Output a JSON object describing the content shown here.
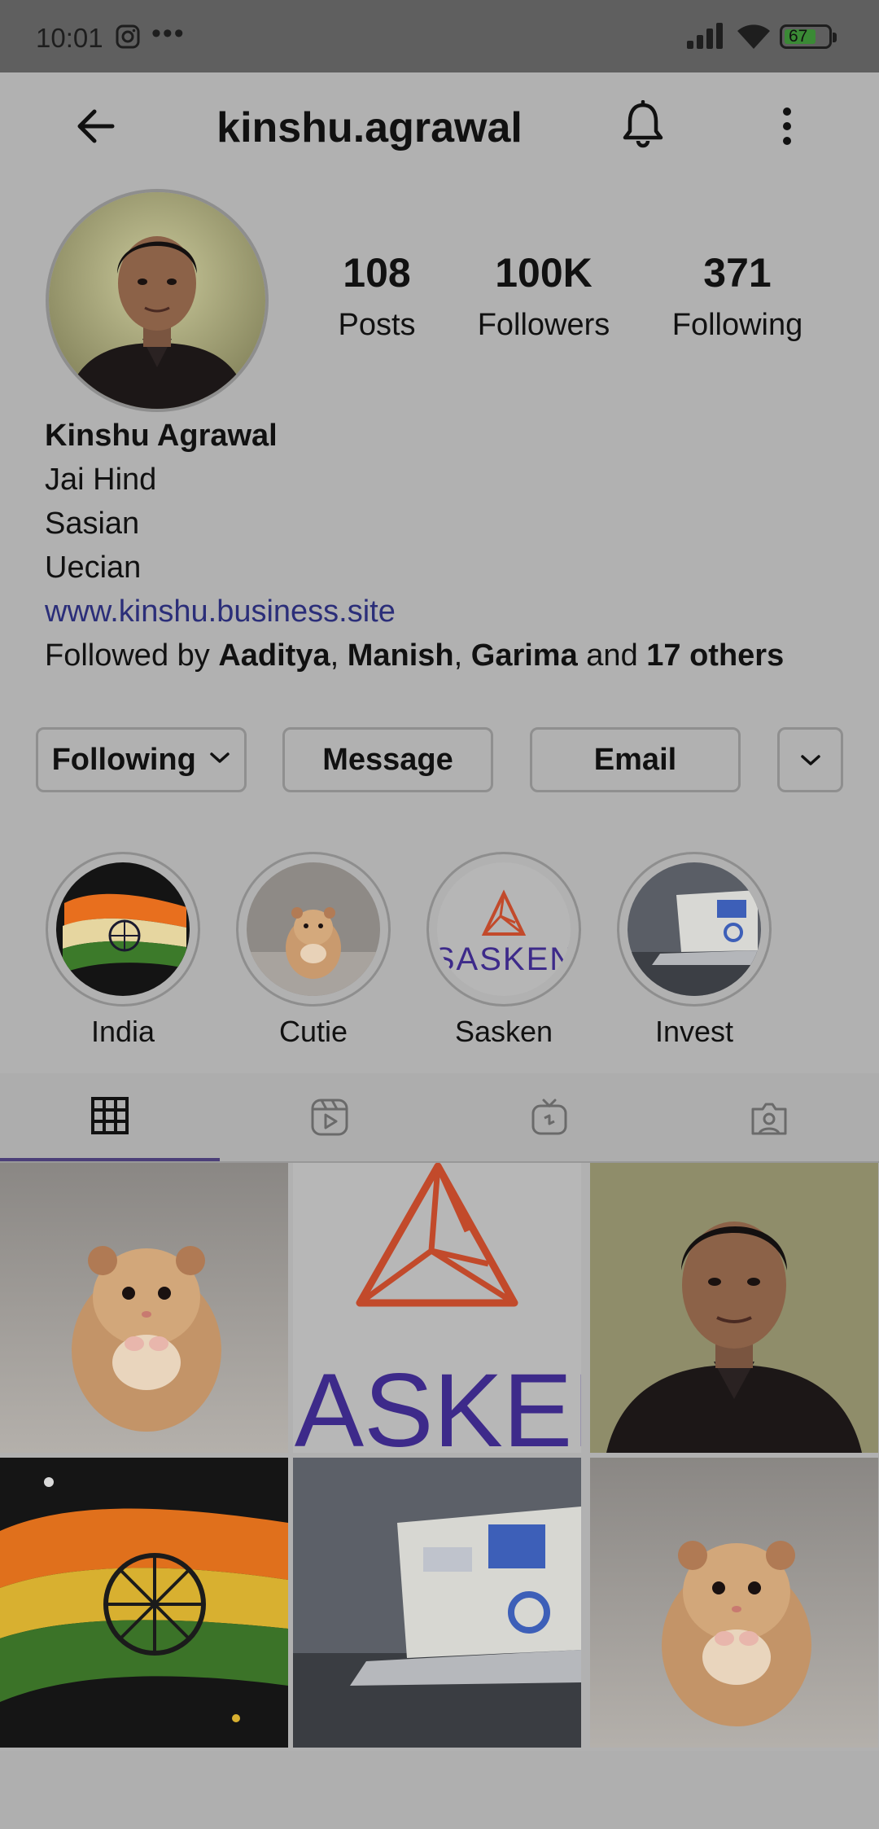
{
  "status_bar": {
    "time": "10:01",
    "battery": "67"
  },
  "header": {
    "username": "kinshu.agrawal"
  },
  "stats": [
    {
      "value": "108",
      "label": "Posts"
    },
    {
      "value": "100K",
      "label": "Followers"
    },
    {
      "value": "371",
      "label": "Following"
    }
  ],
  "bio": {
    "name": "Kinshu Agrawal",
    "lines": [
      "Jai Hind",
      "Sasian",
      "Uecian"
    ],
    "website": "www.kinshu.business.site",
    "followed_prefix": "Followed by",
    "followers": [
      "Aaditya",
      "Manish",
      "Garima"
    ],
    "and_text": "and",
    "others": "17 others"
  },
  "buttons": {
    "following": "Following",
    "message": "Message",
    "email": "Email"
  },
  "highlights": [
    "India",
    "Cutie",
    "Sasken",
    "Invest"
  ],
  "sasken_logo_text": "SASKEN",
  "colors": {
    "accent_tab": "#4b3f78",
    "link": "#2b2e79",
    "sasken_orange": "#c24a2b",
    "sasken_purple": "#3d2a8a"
  }
}
